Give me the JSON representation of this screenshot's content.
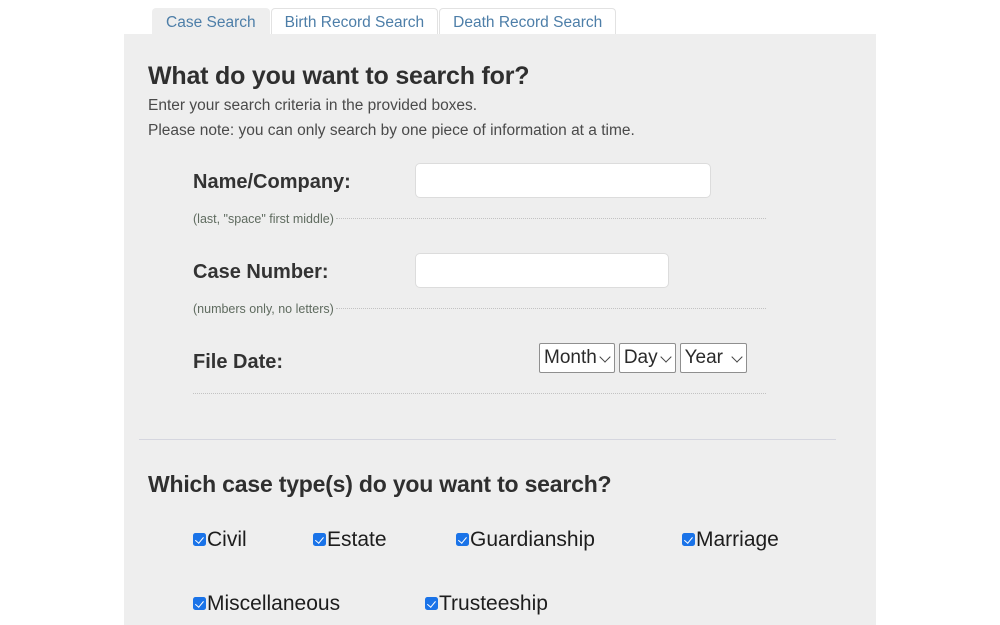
{
  "tabs": [
    {
      "label": "Case Search",
      "active": true
    },
    {
      "label": "Birth Record Search",
      "active": false
    },
    {
      "label": "Death Record Search",
      "active": false
    }
  ],
  "search_section": {
    "heading": "What do you want to search for?",
    "sub_line_1": "Enter your search criteria in the provided boxes.",
    "sub_line_2": "Please note: you can only search by one piece of information at a time.",
    "fields": [
      {
        "label": "Name/Company:",
        "value": "",
        "placeholder": "",
        "hint": "(last, \"space\" first middle)"
      },
      {
        "label": "Case Number:",
        "value": "",
        "placeholder": "",
        "hint": "(numbers only, no letters)"
      }
    ],
    "file_date": {
      "label": "File Date:",
      "month_selected": "Month",
      "day_selected": "Day",
      "year_selected": "Year"
    }
  },
  "case_types_section": {
    "heading": "Which case type(s) do you want to search?",
    "row1": [
      {
        "label": "Civil",
        "checked": true
      },
      {
        "label": "Estate",
        "checked": true
      },
      {
        "label": "Guardianship",
        "checked": true
      },
      {
        "label": "Marriage",
        "checked": true
      }
    ],
    "row2": [
      {
        "label": "Miscellaneous",
        "checked": true
      },
      {
        "label": "Trusteeship",
        "checked": true
      }
    ]
  },
  "colors": {
    "panel_bg": "#eeeeee",
    "tab_text": "#4d7ea8",
    "checkbox_accent": "#1a73e8",
    "divider": "#d5d6df"
  }
}
